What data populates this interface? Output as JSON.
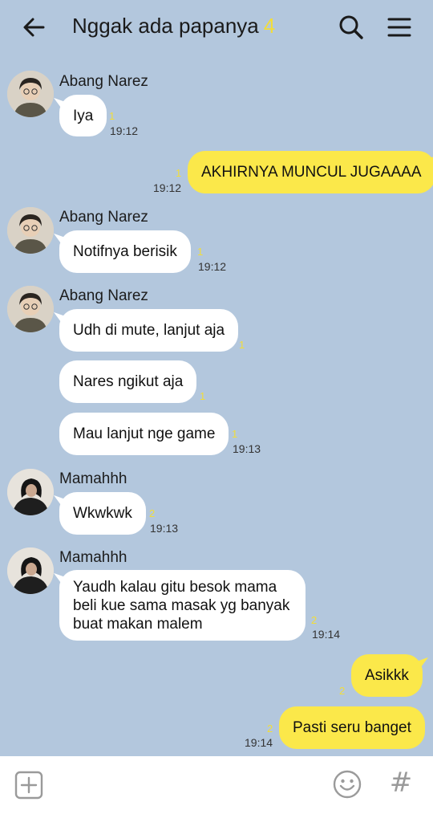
{
  "header": {
    "title": "Nggak ada papanya",
    "member_count": "4"
  },
  "icons": {
    "back": "arrow-left-icon",
    "search": "search-icon",
    "menu": "hamburger-menu-icon",
    "add": "plus-square-icon",
    "emoji": "emoji-smile-icon",
    "hashtag": "hashtag-icon"
  },
  "colors": {
    "chat_background": "#b3c7dd",
    "outgoing_bubble": "#fbe84a",
    "incoming_bubble": "#ffffff",
    "read_count": "#f2dd3a"
  },
  "messages": {
    "m1": {
      "sender": "Abang Narez",
      "text": "Iya",
      "read": "1",
      "time": "19:12"
    },
    "m2": {
      "text": "AKHIRNYA MUNCUL JUGAAAA",
      "read": "1",
      "time": "19:12"
    },
    "m3": {
      "sender": "Abang Narez",
      "text": "Notifnya berisik",
      "read": "1",
      "time": "19:12"
    },
    "m4": {
      "sender": "Abang Narez",
      "text": "Udh di mute, lanjut aja",
      "read": "1"
    },
    "m5": {
      "text": "Nares ngikut aja",
      "read": "1"
    },
    "m6": {
      "text": "Mau lanjut nge game",
      "read": "1",
      "time": "19:13"
    },
    "m7": {
      "sender": "Mamahhh",
      "text": "Wkwkwk",
      "read": "2",
      "time": "19:13"
    },
    "m8": {
      "sender": "Mamahhh",
      "text": "Yaudh kalau gitu besok mama beli kue sama masak yg banyak buat makan malem",
      "read": "2",
      "time": "19:14"
    },
    "m9": {
      "text": "Asikkk",
      "read": "2"
    },
    "m10": {
      "text": "Pasti seru banget",
      "read": "2",
      "time": "19:14"
    }
  },
  "footer": {
    "hashtag_glyph": "#"
  }
}
